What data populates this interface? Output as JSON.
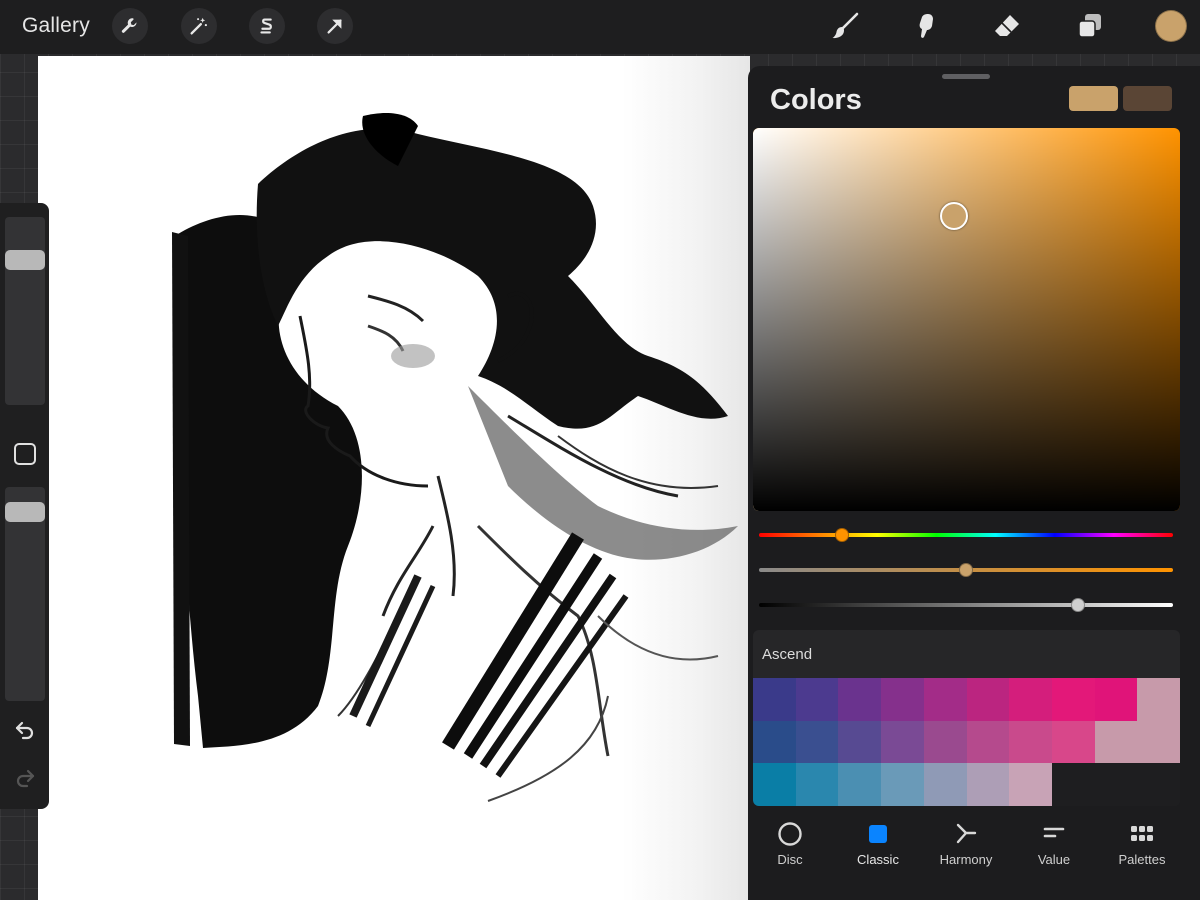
{
  "topbar": {
    "gallery_label": "Gallery",
    "tools_left": [
      {
        "icon": "wrench-icon",
        "label": "Actions"
      },
      {
        "icon": "magic-wand-icon",
        "label": "Adjustments"
      },
      {
        "icon": "selection-icon",
        "label": "Selection"
      },
      {
        "icon": "transform-arrow-icon",
        "label": "Transform"
      }
    ],
    "tools_right": [
      {
        "icon": "brush-icon"
      },
      {
        "icon": "smudge-icon"
      },
      {
        "icon": "eraser-icon"
      },
      {
        "icon": "layers-icon"
      }
    ],
    "current_color": "#c9a26b"
  },
  "sidebar": {
    "brush_size_level": 0.07,
    "opacity_level": 0.05,
    "icons": [
      "square-modify-icon",
      "undo-icon",
      "redo-icon"
    ]
  },
  "colors_panel": {
    "title": "Colors",
    "primary_swatch": "#c9a26b",
    "secondary_swatch": "#5a4535",
    "hue_color": "#ff9300",
    "picker_saturation": 0.47,
    "picker_brightness": 0.77,
    "hue_position": 0.2,
    "saturation_position": 0.5,
    "brightness_position": 0.77,
    "palette": {
      "name": "Ascend",
      "rows": [
        [
          "#3a3a8a",
          "#4c3a8f",
          "#6a338e",
          "#85308c",
          "#a32c88",
          "#bb2580",
          "#d41e7c",
          "#e31879",
          "#e01479",
          "#c79aaa"
        ],
        [
          "#2a4c8a",
          "#3a4f90",
          "#574a92",
          "#7a4a95",
          "#9a4a8f",
          "#b54a8d",
          "#c94a8c",
          "#d8478a",
          "#c79aaa",
          "#c79aaa"
        ],
        [
          "#0a7ea6",
          "#2a87ae",
          "#4b8fb2",
          "#6a9ab8",
          "#8f9ab6",
          "#ad9eb6",
          "#c8a3b6",
          "#1e1e20",
          "#1e1e20",
          "#1e1e20"
        ]
      ]
    },
    "tabs": [
      {
        "label": "Disc",
        "icon": "disc-icon"
      },
      {
        "label": "Classic",
        "icon": "classic-square-icon"
      },
      {
        "label": "Harmony",
        "icon": "harmony-icon"
      },
      {
        "label": "Value",
        "icon": "value-bars-icon"
      },
      {
        "label": "Palettes",
        "icon": "palettes-grid-icon"
      }
    ],
    "active_tab": "Classic"
  }
}
